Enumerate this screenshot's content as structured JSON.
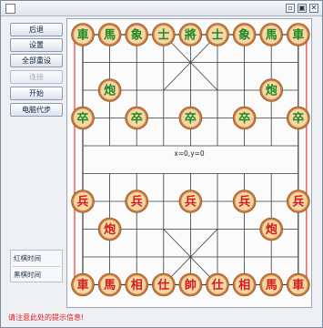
{
  "window": {
    "controls": {
      "minimize": "▫",
      "maximize": "▣",
      "close": "✕"
    }
  },
  "controls": [
    {
      "id": "back",
      "label": "后退",
      "enabled": true
    },
    {
      "id": "settings",
      "label": "设置",
      "enabled": true
    },
    {
      "id": "reset",
      "label": "全部重设",
      "enabled": true
    },
    {
      "id": "connect",
      "label": "连接",
      "enabled": false
    },
    {
      "id": "start",
      "label": "开始",
      "enabled": true
    },
    {
      "id": "ai-move",
      "label": "电脑代步",
      "enabled": true
    }
  ],
  "timers": {
    "red": "红棋时间",
    "black": "黑棋时间"
  },
  "board": {
    "coordinate_readout": "x=0,y=0",
    "colors": {
      "line": "#3a3a3a",
      "piece_face": "#f4d7a6",
      "piece_rim": "#c7783a",
      "black_text": "#1f8a25",
      "red_text": "#d41c1c",
      "marker": "#e84040"
    },
    "pieces": [
      {
        "side": "black",
        "char": "車",
        "col": 0,
        "row": 0
      },
      {
        "side": "black",
        "char": "馬",
        "col": 1,
        "row": 0
      },
      {
        "side": "black",
        "char": "象",
        "col": 2,
        "row": 0
      },
      {
        "side": "black",
        "char": "士",
        "col": 3,
        "row": 0
      },
      {
        "side": "black",
        "char": "將",
        "col": 4,
        "row": 0
      },
      {
        "side": "black",
        "char": "士",
        "col": 5,
        "row": 0
      },
      {
        "side": "black",
        "char": "象",
        "col": 6,
        "row": 0
      },
      {
        "side": "black",
        "char": "馬",
        "col": 7,
        "row": 0
      },
      {
        "side": "black",
        "char": "車",
        "col": 8,
        "row": 0
      },
      {
        "side": "black",
        "char": "炮",
        "col": 1,
        "row": 2
      },
      {
        "side": "black",
        "char": "炮",
        "col": 7,
        "row": 2
      },
      {
        "side": "black",
        "char": "卒",
        "col": 0,
        "row": 3
      },
      {
        "side": "black",
        "char": "卒",
        "col": 2,
        "row": 3
      },
      {
        "side": "black",
        "char": "卒",
        "col": 4,
        "row": 3
      },
      {
        "side": "black",
        "char": "卒",
        "col": 6,
        "row": 3
      },
      {
        "side": "black",
        "char": "卒",
        "col": 8,
        "row": 3
      },
      {
        "side": "red",
        "char": "兵",
        "col": 0,
        "row": 6
      },
      {
        "side": "red",
        "char": "兵",
        "col": 2,
        "row": 6
      },
      {
        "side": "red",
        "char": "兵",
        "col": 4,
        "row": 6
      },
      {
        "side": "red",
        "char": "兵",
        "col": 6,
        "row": 6
      },
      {
        "side": "red",
        "char": "兵",
        "col": 8,
        "row": 6
      },
      {
        "side": "red",
        "char": "炮",
        "col": 1,
        "row": 7
      },
      {
        "side": "red",
        "char": "炮",
        "col": 7,
        "row": 7
      },
      {
        "side": "red",
        "char": "車",
        "col": 0,
        "row": 9
      },
      {
        "side": "red",
        "char": "馬",
        "col": 1,
        "row": 9
      },
      {
        "side": "red",
        "char": "相",
        "col": 2,
        "row": 9
      },
      {
        "side": "red",
        "char": "仕",
        "col": 3,
        "row": 9
      },
      {
        "side": "red",
        "char": "帥",
        "col": 4,
        "row": 9
      },
      {
        "side": "red",
        "char": "仕",
        "col": 5,
        "row": 9
      },
      {
        "side": "red",
        "char": "相",
        "col": 6,
        "row": 9
      },
      {
        "side": "red",
        "char": "馬",
        "col": 7,
        "row": 9
      },
      {
        "side": "red",
        "char": "車",
        "col": 8,
        "row": 9
      }
    ]
  },
  "status": {
    "message": "请注意此处的提示信息!"
  }
}
